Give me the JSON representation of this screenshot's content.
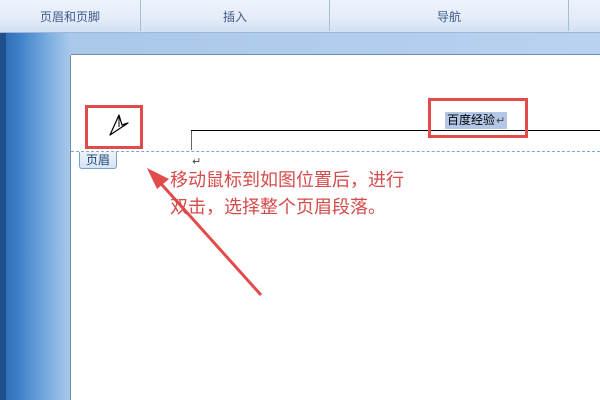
{
  "ribbon": {
    "groups": [
      {
        "label": "页眉和页脚"
      },
      {
        "label": "插入"
      },
      {
        "label": "导航"
      }
    ]
  },
  "document": {
    "header_text": "百度经验",
    "header_tag": "页眉",
    "paragraph_mark": "↵"
  },
  "annotation": {
    "line1": "移动鼠标到如图位置后，进行",
    "line2": "双击，选择整个页眉段落。"
  },
  "colors": {
    "highlight_box": "#e34b4b",
    "annotation_text": "#d64a4a",
    "selection": "#b4c7e7",
    "header_dash": "#7aa7d9"
  },
  "icons": {
    "cursor": "mouse-pointer-icon"
  }
}
